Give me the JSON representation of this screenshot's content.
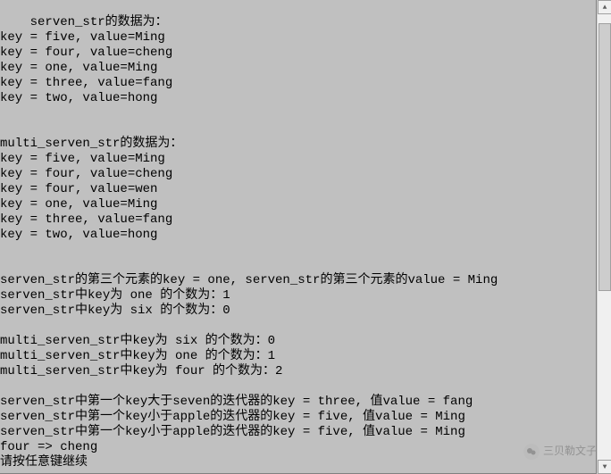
{
  "console": {
    "lines": [
      "serven_str的数据为：",
      "key = five, value=Ming",
      "key = four, value=cheng",
      "key = one, value=Ming",
      "key = three, value=fang",
      "key = two, value=hong",
      "",
      "",
      "multi_serven_str的数据为：",
      "key = five, value=Ming",
      "key = four, value=cheng",
      "key = four, value=wen",
      "key = one, value=Ming",
      "key = three, value=fang",
      "key = two, value=hong",
      "",
      "",
      "serven_str的第三个元素的key = one, serven_str的第三个元素的value = Ming",
      "serven_str中key为 one 的个数为：1",
      "serven_str中key为 six 的个数为：0",
      "",
      "multi_serven_str中key为 six 的个数为：0",
      "multi_serven_str中key为 one 的个数为：1",
      "multi_serven_str中key为 four 的个数为：2",
      "",
      "serven_str中第一个key大于seven的迭代器的key = three, 值value = fang",
      "serven_str中第一个key小于apple的迭代器的key = five, 值value = Ming",
      "serven_str中第一个key小于apple的迭代器的key = five, 值value = Ming",
      "four => cheng",
      "请按任意键继续"
    ]
  },
  "watermark": {
    "text": "三贝勒文子"
  }
}
